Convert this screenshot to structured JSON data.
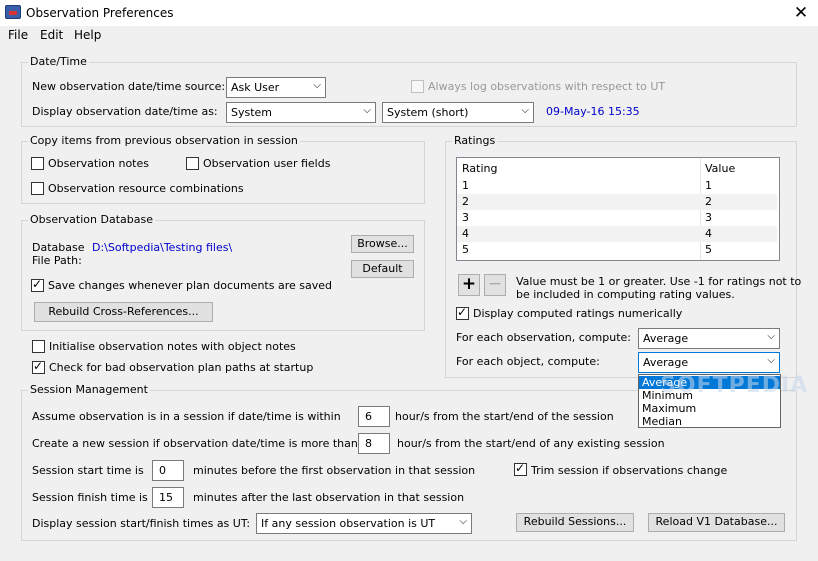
{
  "window": {
    "title": "Observation Preferences",
    "close": "✕"
  },
  "menu": [
    "File",
    "Edit",
    "Help"
  ],
  "datetime": {
    "group_label": "Date/Time",
    "source_label": "New observation date/time source:",
    "source_value": "Ask User",
    "always_ut_label": "Always log observations with respect to UT",
    "display_label": "Display observation date/time as:",
    "display_value": "System",
    "display_format": "System (short)",
    "preview": "09-May-16  15:35"
  },
  "copy": {
    "group_label": "Copy items from previous observation in session",
    "notes": "Observation notes",
    "user_fields": "Observation user fields",
    "resources": "Observation resource combinations"
  },
  "database": {
    "group_label": "Observation Database",
    "path_label_1": "Database",
    "path_label_2": "File Path:",
    "path_value": "D:\\Softpedia\\Testing files\\",
    "browse": "Browse...",
    "default": "Default",
    "save_label": "Save changes whenever plan documents are saved",
    "rebuild": "Rebuild Cross-References..."
  },
  "misc": {
    "init_notes": "Initialise observation notes with object notes",
    "check_paths": "Check for bad observation plan paths at startup"
  },
  "ratings": {
    "group_label": "Ratings",
    "col_rating": "Rating",
    "col_value": "Value",
    "rows": [
      [
        "1",
        "1"
      ],
      [
        "2",
        "2"
      ],
      [
        "3",
        "3"
      ],
      [
        "4",
        "4"
      ],
      [
        "5",
        "5"
      ]
    ],
    "add": "+",
    "remove": "−",
    "hint_1": "Value must be 1 or greater. Use -1 for ratings not to",
    "hint_2": "be included in computing rating values.",
    "display_numeric": "Display computed ratings numerically",
    "per_obs_label": "For each observation, compute:",
    "per_obs_value": "Average",
    "per_obj_label": "For each object, compute:",
    "per_obj_value": "Average",
    "options": [
      "Average",
      "Minimum",
      "Maximum",
      "Median"
    ],
    "watermark": "SOFTPEDIA"
  },
  "session": {
    "group_label": "Session Management",
    "assume_label": "Assume observation is in a session if date/time is within",
    "assume_value": "6",
    "assume_suffix": "hour/s from the start/end of the session",
    "new_label": "Create a new session if observation date/time is more than",
    "new_value": "8",
    "new_suffix": "hour/s from the start/end of any existing session",
    "start_label": "Session start time is",
    "start_value": "0",
    "start_suffix": "minutes before the first observation in that session",
    "trim_label": "Trim session if observations change",
    "finish_label": "Session finish time is",
    "finish_value": "15",
    "finish_suffix": "minutes after the last observation in that session",
    "ut_label": "Display session start/finish times as UT:",
    "ut_value": "If any session observation is UT",
    "rebuild": "Rebuild Sessions...",
    "reload": "Reload V1 Database..."
  }
}
